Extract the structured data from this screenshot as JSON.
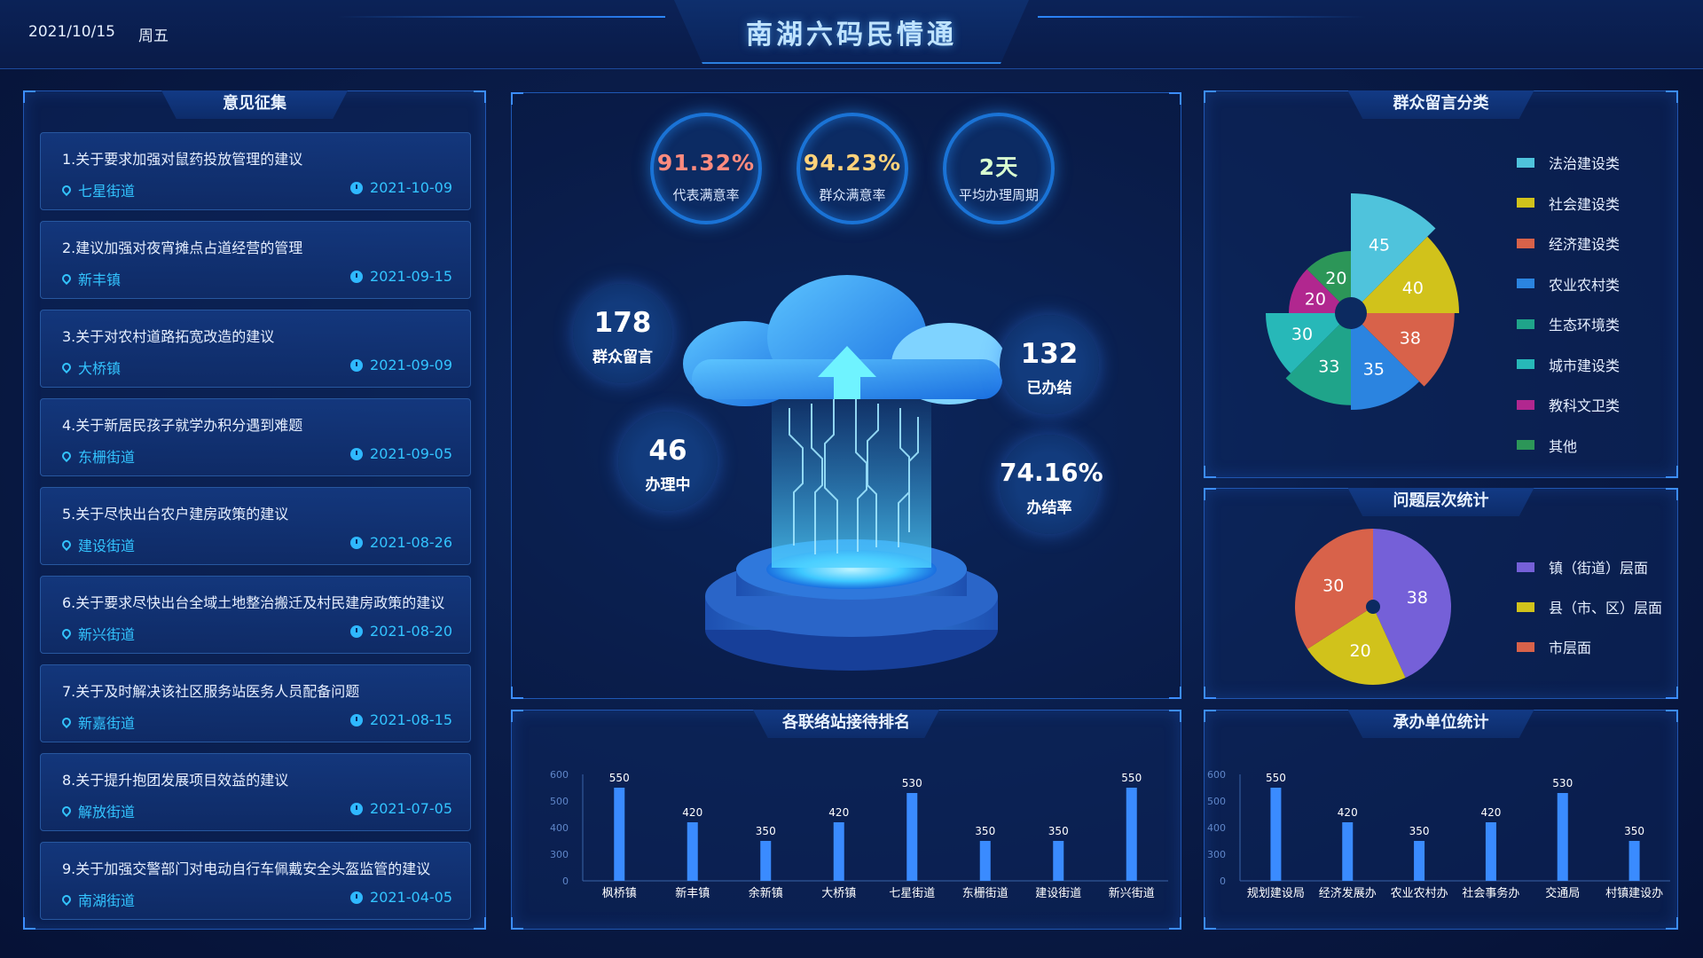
{
  "header": {
    "date": "2021/10/15",
    "weekday": "周五",
    "title": "南湖六码民情通"
  },
  "opinions": {
    "title": "意见征集",
    "items": [
      {
        "title": "1.关于要求加强对鼠药投放管理的建议",
        "location": "七星街道",
        "date": "2021-10-09"
      },
      {
        "title": "2.建议加强对夜宵摊点占道经营的管理",
        "location": "新丰镇",
        "date": "2021-09-15"
      },
      {
        "title": "3.关于对农村道路拓宽改造的建议",
        "location": "大桥镇",
        "date": "2021-09-09"
      },
      {
        "title": "4.关于新居民孩子就学办积分遇到难题",
        "location": "东栅街道",
        "date": "2021-09-05"
      },
      {
        "title": "5.关于尽快出台农户建房政策的建议",
        "location": "建设街道",
        "date": "2021-08-26"
      },
      {
        "title": "6.关于要求尽快出台全域土地整治搬迁及村民建房政策的建议",
        "location": "新兴街道",
        "date": "2021-08-20"
      },
      {
        "title": "7.关于及时解决该社区服务站医务人员配备问题",
        "location": "新嘉街道",
        "date": "2021-08-15"
      },
      {
        "title": "8.关于提升抱团发展项目效益的建议",
        "location": "解放街道",
        "date": "2021-07-05"
      },
      {
        "title": "9.关于加强交警部门对电动自行车佩戴安全头盔监管的建议",
        "location": "南湖街道",
        "date": "2021-04-05"
      }
    ]
  },
  "center": {
    "rates": [
      {
        "value": "91.32%",
        "label": "代表满意率",
        "color": "#ff8b7e"
      },
      {
        "value": "94.23%",
        "label": "群众满意率",
        "color": "#ffd27a"
      },
      {
        "value": "2天",
        "label": "平均办理周期",
        "color": "#d9ffd0"
      }
    ],
    "bubbles": [
      {
        "value": "178",
        "label": "群众留言"
      },
      {
        "value": "46",
        "label": "办理中"
      },
      {
        "value": "132",
        "label": "已办结"
      },
      {
        "value": "74.16%",
        "label": "办结率"
      }
    ]
  },
  "chart_data": [
    {
      "type": "pie",
      "title": "群众留言分类",
      "categories": [
        "法治建设类",
        "社会建设类",
        "经济建设类",
        "农业农村类",
        "生态环境类",
        "城市建设类",
        "教科文卫类",
        "其他"
      ],
      "values": [
        45,
        40,
        38,
        35,
        33,
        30,
        20,
        20
      ],
      "colors": [
        "#4fc3dc",
        "#d1c21b",
        "#d8624a",
        "#2b84e0",
        "#1fa48a",
        "#27b8b8",
        "#b1278f",
        "#2c9658"
      ],
      "legend": "right",
      "variant": "rose"
    },
    {
      "type": "pie",
      "title": "问题层次统计",
      "categories": [
        "镇（街道）层面",
        "县（市、区）层面",
        "市层面"
      ],
      "values": [
        38,
        20,
        30
      ],
      "colors": [
        "#7560d8",
        "#d1c21b",
        "#d8624a"
      ],
      "legend": "right"
    },
    {
      "type": "bar",
      "title": "各联络站接待排名",
      "categories": [
        "枫桥镇",
        "新丰镇",
        "余新镇",
        "大桥镇",
        "七星街道",
        "东栅街道",
        "建设街道",
        "新兴街道"
      ],
      "values": [
        550,
        420,
        350,
        420,
        530,
        350,
        350,
        550
      ],
      "yticks": [
        "0",
        "300",
        "400",
        "500",
        "600"
      ],
      "color": "#3a8bff"
    },
    {
      "type": "bar",
      "title": "承办单位统计",
      "categories": [
        "规划建设局",
        "经济发展办",
        "农业农村办",
        "社会事务办",
        "交通局",
        "村镇建设办"
      ],
      "values": [
        550,
        420,
        350,
        420,
        530,
        350
      ],
      "yticks": [
        "0",
        "300",
        "400",
        "500",
        "600"
      ],
      "color": "#3a8bff"
    }
  ]
}
